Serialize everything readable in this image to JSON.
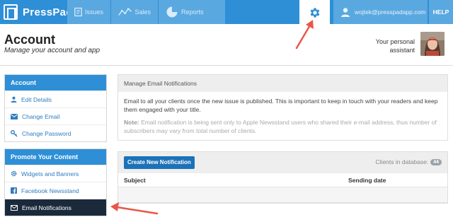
{
  "app": {
    "name": "PressPad"
  },
  "nav": {
    "items": [
      {
        "label": "Issues",
        "icon": "document-icon"
      },
      {
        "label": "Sales",
        "icon": "line-chart-icon"
      },
      {
        "label": "Reports",
        "icon": "pie-chart-icon"
      }
    ],
    "settings_icon": "gear-icon",
    "user_email": "wojtek@presspadapp.com",
    "help_label": "HELP"
  },
  "page": {
    "title": "Account",
    "subtitle": "Manage your account and app",
    "assistant_label": "Your personal assistant"
  },
  "sidebar": {
    "account": {
      "heading": "Account",
      "items": [
        {
          "label": "Edit Details",
          "icon": "user-icon"
        },
        {
          "label": "Change Email",
          "icon": "envelope-icon"
        },
        {
          "label": "Change Password",
          "icon": "key-icon"
        }
      ]
    },
    "promote": {
      "heading": "Promote Your Content",
      "items": [
        {
          "label": "Widgets and Banners",
          "icon": "cog-icon"
        },
        {
          "label": "Facebook Newsstand",
          "icon": "facebook-icon"
        },
        {
          "label": "Email Notifications",
          "icon": "envelope-icon",
          "active": true
        }
      ]
    }
  },
  "main": {
    "heading": "Manage Email Notifications",
    "description": "Email to all your clients once the new issue is published. This is important to keep in touch with your readers and keep them engaged with your title.",
    "note_label": "Note:",
    "note_text": " Email notification is being sent only to Apple Newsstand users who shared their e-mail address, thus number of subscribers may vary from total number of clients.",
    "create_button": "Create New Notification",
    "clients_label": "Clients in database:",
    "clients_count": "44",
    "columns": [
      "Subject",
      "Sending date"
    ]
  },
  "colors": {
    "brand": "#2e8fd7",
    "nav_tab": "#5aa8e0",
    "active_item": "#1b2a3b",
    "button": "#1c72b8",
    "arrow": "#e8584a"
  }
}
